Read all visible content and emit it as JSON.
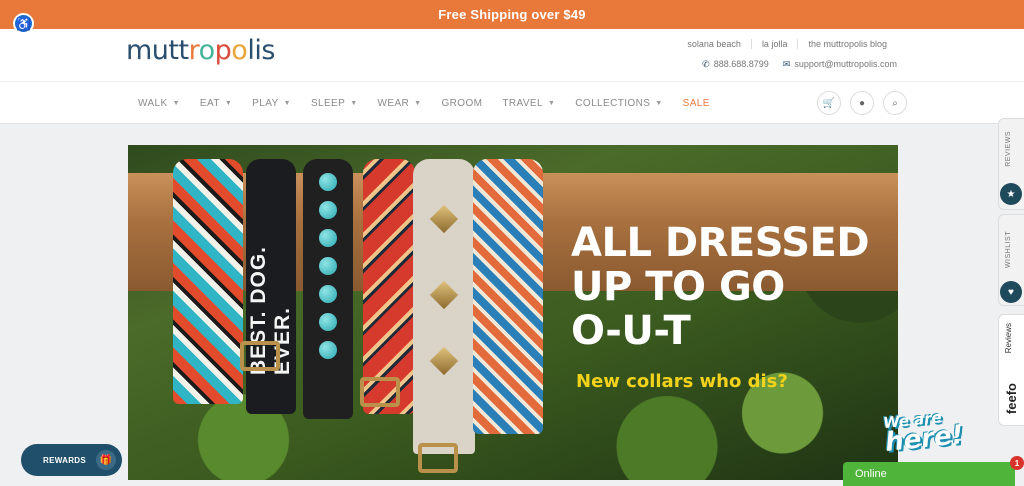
{
  "promo": {
    "text": "Free Shipping over $49"
  },
  "accessibility": {
    "icon": "wheelchair-icon"
  },
  "header": {
    "logo": {
      "m": "mutt",
      "o1": "r",
      "o2": "o",
      "o3": "p",
      "l": "o",
      "rest": "lis"
    },
    "store_links": [
      "solana beach",
      "la jolla",
      "the muttropolis blog"
    ],
    "phone": "888.688.8799",
    "email": "support@muttropolis.com"
  },
  "nav": {
    "items": [
      "WALK",
      "EAT",
      "PLAY",
      "SLEEP",
      "WEAR",
      "GROOM",
      "TRAVEL",
      "COLLECTIONS",
      "SALE"
    ],
    "icons": [
      "cart-icon",
      "user-icon",
      "search-icon"
    ]
  },
  "hero": {
    "headline_1": "ALL DRESSED",
    "headline_2": "UP TO GO",
    "headline_3": "O-U-T",
    "subline": "New collars who dis?",
    "collar_text": "BEST. DOG. EVER."
  },
  "side_tabs": {
    "reviews": "REVIEWS",
    "wishlist": "WISHLIST",
    "feefo_reviews": "Reviews",
    "feefo_logo": "feefo"
  },
  "rewards": {
    "label": "REWARDS"
  },
  "chat": {
    "we_are": "We are",
    "here": "here!",
    "status": "Online",
    "badge": "1"
  },
  "colors": {
    "promo": "#e9793a",
    "brand": "#2a4f6e",
    "online": "#4fb43a",
    "sale": "#e9793a"
  }
}
